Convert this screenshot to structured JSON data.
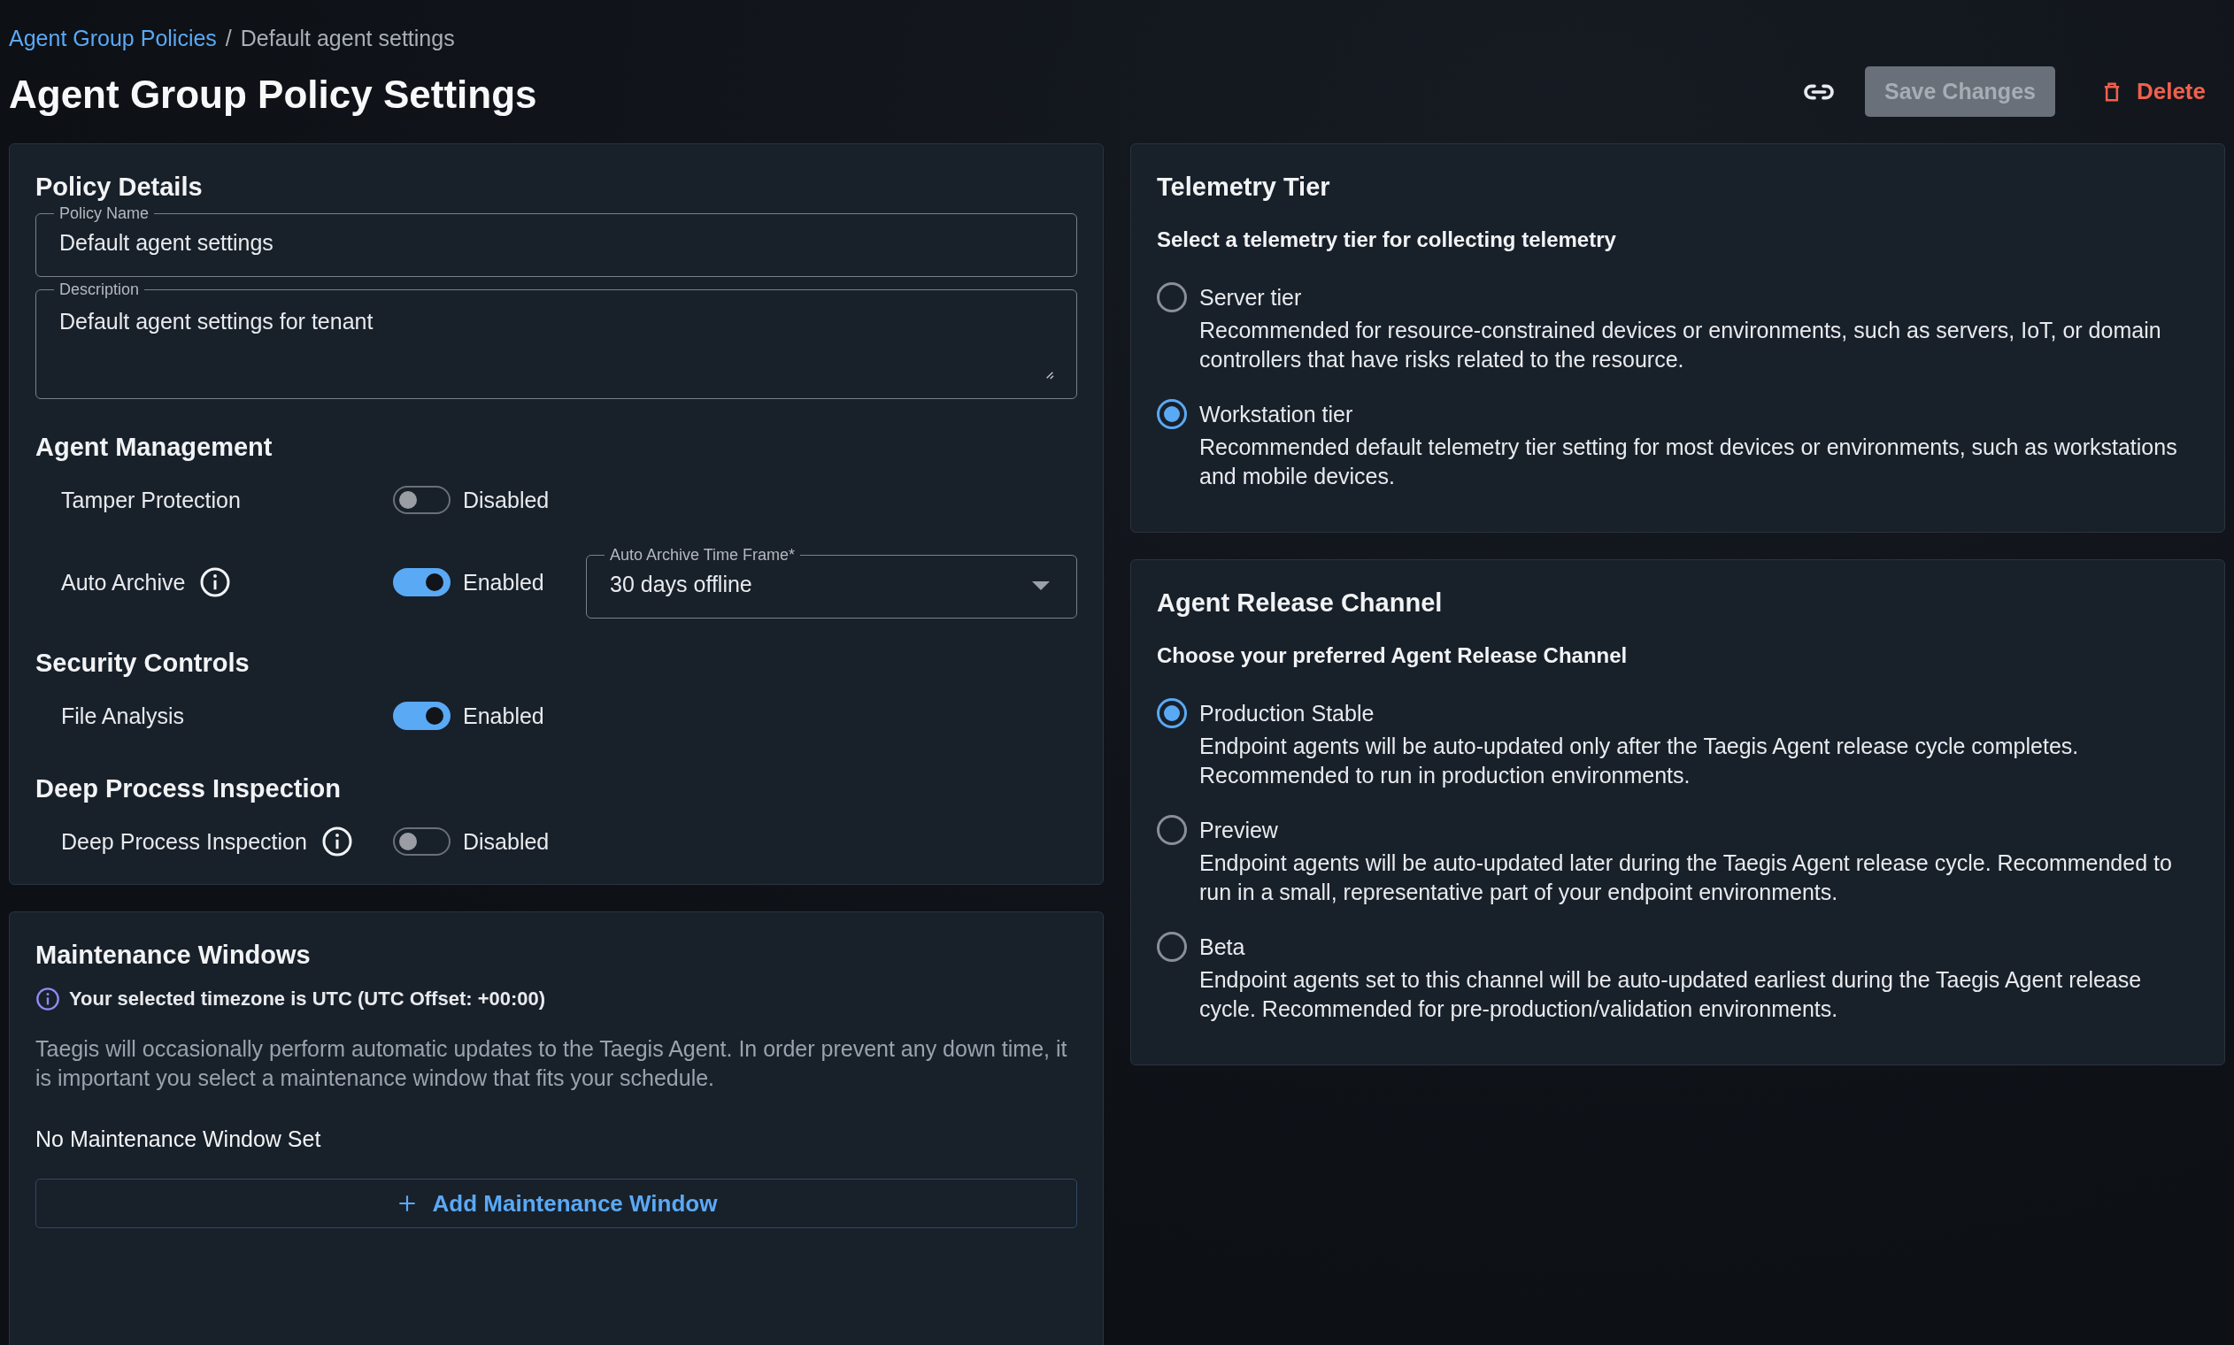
{
  "breadcrumb": {
    "parent": "Agent Group Policies",
    "separator": "/",
    "current": "Default agent settings"
  },
  "title": "Agent Group Policy Settings",
  "actions": {
    "save": {
      "label": "Save Changes",
      "disabled": true
    },
    "delete": {
      "label": "Delete"
    }
  },
  "policy_details": {
    "title": "Policy Details",
    "fields": [
      {
        "kind": "input",
        "label": "Policy Name",
        "value": "Default agent settings"
      },
      {
        "kind": "textarea",
        "label": "Description",
        "value": "Default agent settings for tenant"
      }
    ],
    "sections": [
      {
        "title": "Agent Management",
        "settings": [
          {
            "label": "Tamper Protection",
            "info": false,
            "on": false,
            "state": "Disabled"
          },
          {
            "label": "Auto Archive",
            "info": true,
            "on": true,
            "state": "Enabled",
            "select": {
              "label": "Auto Archive Time Frame*",
              "value": "30 days offline"
            }
          }
        ]
      },
      {
        "title": "Security Controls",
        "settings": [
          {
            "label": "File Analysis",
            "info": false,
            "on": true,
            "state": "Enabled"
          }
        ]
      },
      {
        "title": "Deep Process Inspection",
        "settings": [
          {
            "label": "Deep Process Inspection",
            "info": true,
            "on": false,
            "state": "Disabled"
          }
        ]
      }
    ]
  },
  "maintenance": {
    "title": "Maintenance Windows",
    "notice": "Your selected timezone is UTC (UTC Offset: +00:00)",
    "description": "Taegis will occasionally perform automatic updates to the Taegis Agent. In order prevent any down time, it is important you select a maintenance window that fits your schedule.",
    "empty": "No Maintenance Window Set",
    "add_button": "Add Maintenance Window"
  },
  "telemetry": {
    "title": "Telemetry Tier",
    "prompt": "Select a telemetry tier for collecting telemetry",
    "options": [
      {
        "label": "Server tier",
        "description": "Recommended for resource-constrained devices or environments, such as servers, IoT, or domain controllers that have risks related to the resource.",
        "selected": false
      },
      {
        "label": "Workstation tier",
        "description": "Recommended default telemetry tier setting for most devices or environments, such as workstations and mobile devices.",
        "selected": true
      }
    ]
  },
  "release_channel": {
    "title": "Agent Release Channel",
    "prompt": "Choose your preferred Agent Release Channel",
    "options": [
      {
        "label": "Production Stable",
        "description": "Endpoint agents will be auto-updated only after the Taegis Agent release cycle completes. Recommended to run in production environments.",
        "selected": true
      },
      {
        "label": "Preview",
        "description": "Endpoint agents will be auto-updated later during the Taegis Agent release cycle. Recommended to run in a small, representative part of your endpoint environments.",
        "selected": false
      },
      {
        "label": "Beta",
        "description": "Endpoint agents set to this channel will be auto-updated earliest during the Taegis Agent release cycle. Recommended for pre-production/validation environments.",
        "selected": false
      }
    ]
  }
}
